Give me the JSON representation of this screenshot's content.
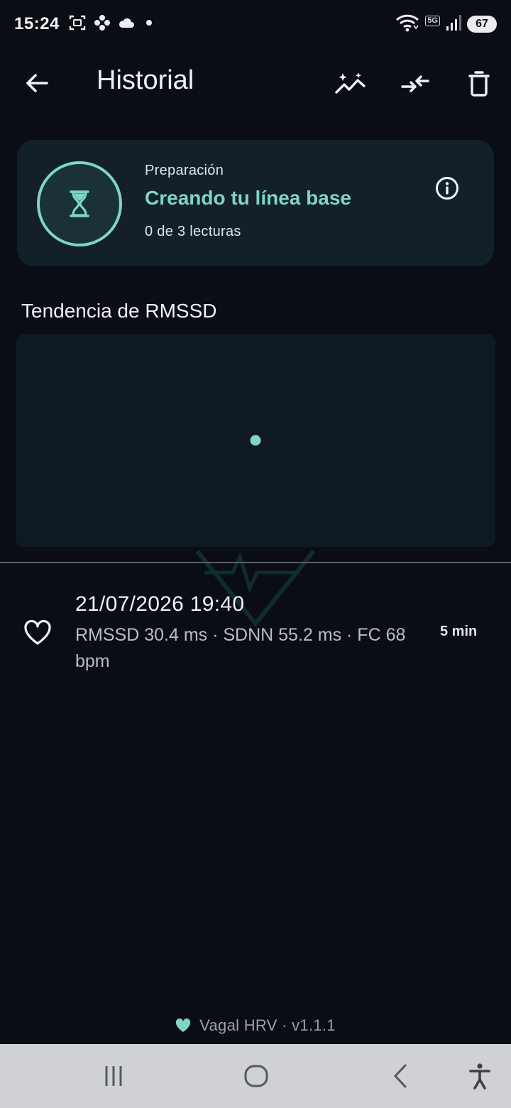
{
  "status_bar": {
    "time": "15:24",
    "network": "5G",
    "battery": "67",
    "icons": [
      "screenshot-icon",
      "flower-icon",
      "cloud-icon",
      "dot-icon",
      "wifi-icon",
      "signal-icon"
    ]
  },
  "app_bar": {
    "title": "Historial",
    "actions": [
      "back-arrow-icon",
      "trend-sparkle-icon",
      "compare-icon",
      "trash-icon"
    ]
  },
  "baseline_card": {
    "overline": "Preparación",
    "title": "Creando tu línea base",
    "subtitle": "0 de 3 lecturas",
    "icons": [
      "hourglass-icon",
      "info-icon"
    ]
  },
  "trend": {
    "title": "Tendencia de RMSSD"
  },
  "chart_data": {
    "type": "scatter",
    "title": "Tendencia de RMSSD",
    "x": [
      "21/07/2026 19:40"
    ],
    "series": [
      {
        "values": [
          30.4
        ]
      }
    ],
    "grid": false
  },
  "sessions": [
    {
      "date": "21/07/2026 19:40",
      "metrics": "RMSSD 30.4 ms · SDNN 55.2 ms · FC 68 bpm",
      "duration": "5 min",
      "icon": "heart-outline-icon"
    }
  ],
  "footer": {
    "text": "Vagal HRV · v1.1.1",
    "icon": "heart-icon"
  },
  "nav_bar": {
    "buttons": [
      "recents-icon",
      "home-icon",
      "back-icon",
      "accessibility-icon"
    ]
  },
  "colors": {
    "background": "#0a0d14",
    "accent": "#7ed6c5",
    "card": "#13202a",
    "chart_bg": "#0f1922",
    "nav_bar": "#cfd1d4"
  }
}
